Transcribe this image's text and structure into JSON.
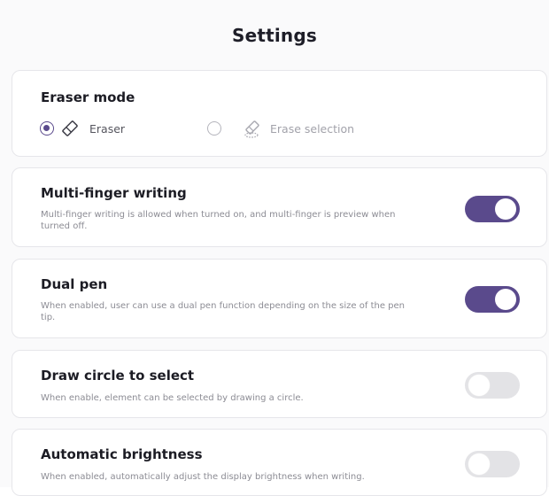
{
  "header": {
    "title": "Settings"
  },
  "eraser_mode": {
    "title": "Eraser mode",
    "options": [
      {
        "label": "Eraser",
        "selected": true,
        "icon": "eraser-icon"
      },
      {
        "label": "Erase selection",
        "selected": false,
        "icon": "erase-selection-icon"
      }
    ]
  },
  "settings": [
    {
      "title": "Multi-finger writing",
      "description": "Multi-finger writing is allowed when turned on, and multi-finger is preview when turned off.",
      "enabled": true
    },
    {
      "title": "Dual pen",
      "description": "When enabled, user can use a dual pen function depending on the size of the pen tip.",
      "enabled": true
    },
    {
      "title": "Draw circle to select",
      "description": "When enable, element can be selected by drawing a circle.",
      "enabled": false
    },
    {
      "title": "Automatic brightness",
      "description": "When enabled, automatically adjust the display brightness when writing.",
      "enabled": false
    }
  ],
  "colors": {
    "accent": "#5a4a8c",
    "toggle_off": "#e3e3e6",
    "card_border": "#e6e6ea"
  }
}
